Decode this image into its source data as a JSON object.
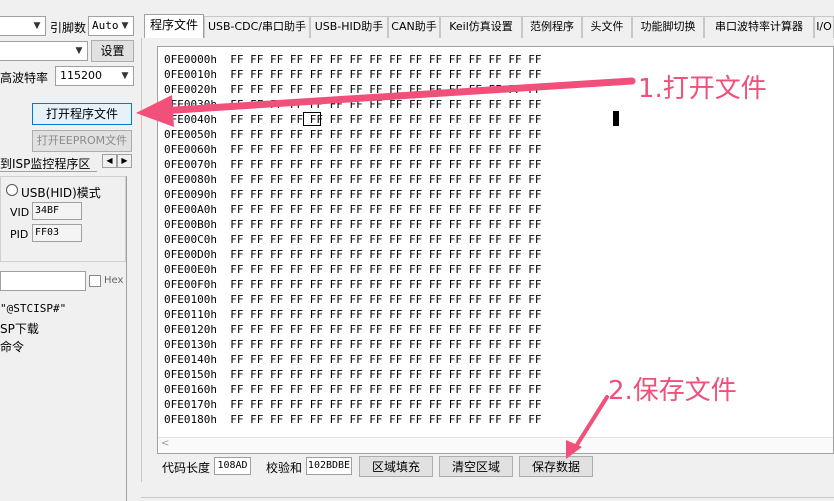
{
  "left_panel": {
    "pin_count_label": "引脚数",
    "pin_count_value": "Auto",
    "settings_button": "设置",
    "baud_label": "高波特率",
    "baud_value": "115200",
    "open_program_button": "打开程序文件",
    "open_eeprom_button": "打开EEPROM文件",
    "isp_tab_label": "到ISP监控程序区",
    "usb_hid_mode_label": "USB(HID)模式",
    "vid_label": "VID",
    "vid_value": "34BF",
    "pid_label": "PID",
    "pid_value": "FF03",
    "hex_checkbox_label": "Hex",
    "text_line_1": "\"@STCISP#\"",
    "text_line_2": "SP下载",
    "text_line_3": "命令"
  },
  "tabs": [
    {
      "label": "程序文件",
      "active": true
    },
    {
      "label": "USB-CDC/串口助手",
      "active": false
    },
    {
      "label": "USB-HID助手",
      "active": false
    },
    {
      "label": "CAN助手",
      "active": false
    },
    {
      "label": "Keil仿真设置",
      "active": false
    },
    {
      "label": "范例程序",
      "active": false
    },
    {
      "label": "头文件",
      "active": false
    },
    {
      "label": "功能脚切换",
      "active": false
    },
    {
      "label": "串口波特率计算器",
      "active": false
    },
    {
      "label": "I/O",
      "active": false
    }
  ],
  "hex_view": {
    "rows": [
      {
        "address": "0FE0000h",
        "bytes": "FF FF FF FF FF FF FF FF FF FF FF FF FF FF FF FF"
      },
      {
        "address": "0FE0010h",
        "bytes": "FF FF FF FF FF FF FF FF FF FF FF FF FF FF FF FF"
      },
      {
        "address": "0FE0020h",
        "bytes": "FF FF FF FF FF FF FF FF FF FF FF FF FF FF FF FF"
      },
      {
        "address": "0FE0030h",
        "bytes": "FF FF FF FF FF FF FF FF FF FF FF FF FF FF FF FF"
      },
      {
        "address": "0FE0040h",
        "bytes": "FF FF FF FF FF FF FF FF FF FF FF FF FF FF FF FF"
      },
      {
        "address": "0FE0050h",
        "bytes": "FF FF FF FF FF FF FF FF FF FF FF FF FF FF FF FF"
      },
      {
        "address": "0FE0060h",
        "bytes": "FF FF FF FF FF FF FF FF FF FF FF FF FF FF FF FF"
      },
      {
        "address": "0FE0070h",
        "bytes": "FF FF FF FF FF FF FF FF FF FF FF FF FF FF FF FF"
      },
      {
        "address": "0FE0080h",
        "bytes": "FF FF FF FF FF FF FF FF FF FF FF FF FF FF FF FF"
      },
      {
        "address": "0FE0090h",
        "bytes": "FF FF FF FF FF FF FF FF FF FF FF FF FF FF FF FF"
      },
      {
        "address": "0FE00A0h",
        "bytes": "FF FF FF FF FF FF FF FF FF FF FF FF FF FF FF FF"
      },
      {
        "address": "0FE00B0h",
        "bytes": "FF FF FF FF FF FF FF FF FF FF FF FF FF FF FF FF"
      },
      {
        "address": "0FE00C0h",
        "bytes": "FF FF FF FF FF FF FF FF FF FF FF FF FF FF FF FF"
      },
      {
        "address": "0FE00D0h",
        "bytes": "FF FF FF FF FF FF FF FF FF FF FF FF FF FF FF FF"
      },
      {
        "address": "0FE00E0h",
        "bytes": "FF FF FF FF FF FF FF FF FF FF FF FF FF FF FF FF"
      },
      {
        "address": "0FE00F0h",
        "bytes": "FF FF FF FF FF FF FF FF FF FF FF FF FF FF FF FF"
      },
      {
        "address": "0FE0100h",
        "bytes": "FF FF FF FF FF FF FF FF FF FF FF FF FF FF FF FF"
      },
      {
        "address": "0FE0110h",
        "bytes": "FF FF FF FF FF FF FF FF FF FF FF FF FF FF FF FF"
      },
      {
        "address": "0FE0120h",
        "bytes": "FF FF FF FF FF FF FF FF FF FF FF FF FF FF FF FF"
      },
      {
        "address": "0FE0130h",
        "bytes": "FF FF FF FF FF FF FF FF FF FF FF FF FF FF FF FF"
      },
      {
        "address": "0FE0140h",
        "bytes": "FF FF FF FF FF FF FF FF FF FF FF FF FF FF FF FF"
      },
      {
        "address": "0FE0150h",
        "bytes": "FF FF FF FF FF FF FF FF FF FF FF FF FF FF FF FF"
      },
      {
        "address": "0FE0160h",
        "bytes": "FF FF FF FF FF FF FF FF FF FF FF FF FF FF FF FF"
      },
      {
        "address": "0FE0170h",
        "bytes": "FF FF FF FF FF FF FF FF FF FF FF FF FF FF FF FF"
      },
      {
        "address": "0FE0180h",
        "bytes": "FF FF FF FF FF FF FF FF FF FF FF FF FF FF FF FF"
      }
    ]
  },
  "bottom_bar": {
    "code_length_label": "代码长度",
    "code_length_value": "108AD",
    "checksum_label": "校验和",
    "checksum_value": "102BDBE",
    "fill_region_button": "区域填充",
    "clear_region_button": "清空区域",
    "save_data_button": "保存数据"
  },
  "annotations": {
    "step1": "1.打开文件",
    "step2": "2.保存文件",
    "color": "#f0507a"
  }
}
